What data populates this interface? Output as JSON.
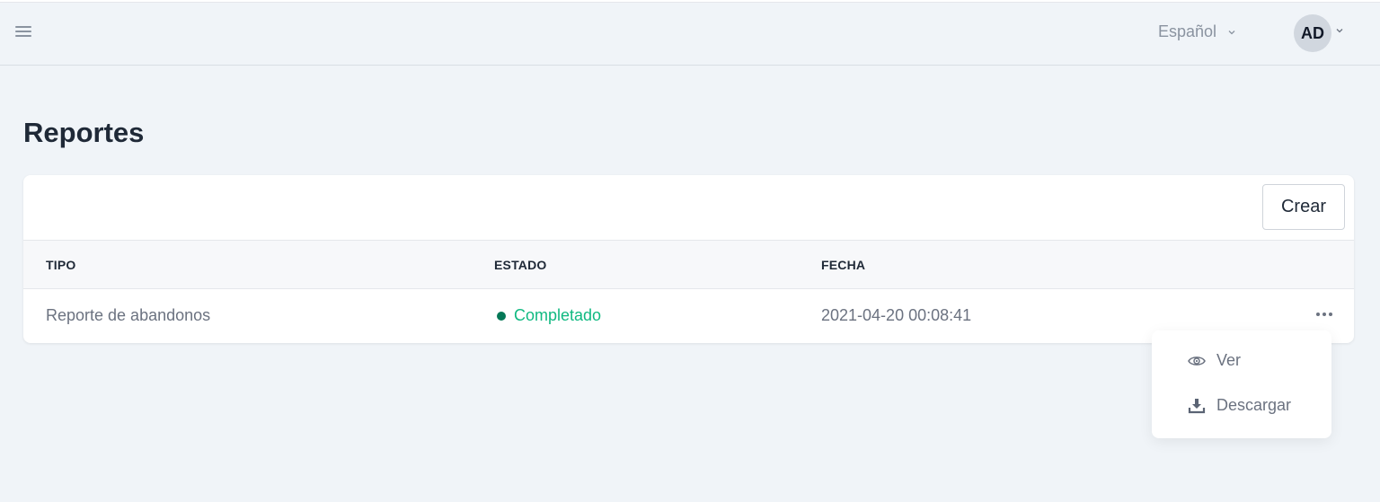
{
  "header": {
    "language": "Español",
    "avatar_initials": "AD"
  },
  "page": {
    "title": "Reportes"
  },
  "toolbar": {
    "create_label": "Crear"
  },
  "table": {
    "columns": [
      "TIPO",
      "ESTADO",
      "FECHA"
    ],
    "rows": [
      {
        "tipo": "Reporte de abandonos",
        "estado": "Completado",
        "fecha": "2021-04-20 00:08:41"
      }
    ]
  },
  "row_menu": {
    "items": [
      {
        "label": "Ver",
        "icon": "eye-icon"
      },
      {
        "label": "Descargar",
        "icon": "download-icon"
      }
    ]
  },
  "colors": {
    "background": "#f0f4f8",
    "status_text": "#10b981",
    "status_dot": "#047857"
  }
}
